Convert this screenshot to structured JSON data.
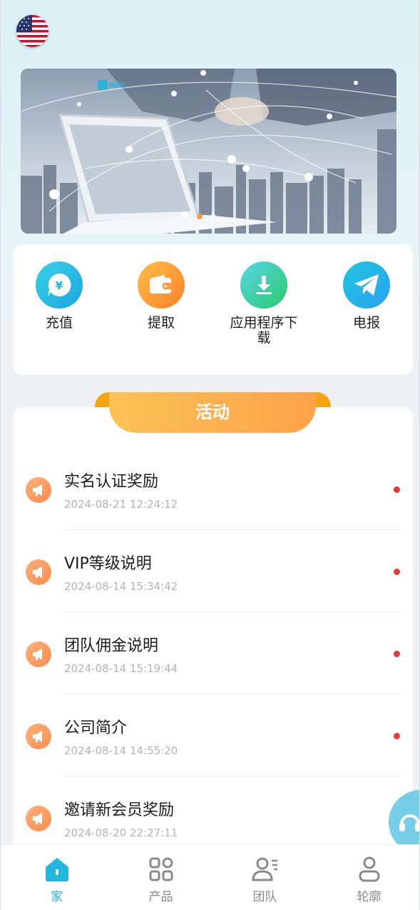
{
  "header": {
    "language_flag": "us-flag-icon"
  },
  "banner": {
    "image": "business handshake over city skyline banner",
    "active_slide": 1,
    "slide_count": 2
  },
  "quick_actions": [
    {
      "label": "充值",
      "icon": "recharge-icon",
      "color": "#1ab6e0"
    },
    {
      "label": "提取",
      "icon": "wallet-icon",
      "color": "#fb8c2f"
    },
    {
      "label": "应用程序下载",
      "icon": "download-icon",
      "color": "#2fd18a"
    },
    {
      "label": "电报",
      "icon": "telegram-icon",
      "color": "#1ab6e0"
    }
  ],
  "activity": {
    "title": "活动",
    "items": [
      {
        "title": "实名认证奖励",
        "time": "2024-08-21 12:24:12"
      },
      {
        "title": "VIP等级说明",
        "time": "2024-08-14 15:34:42"
      },
      {
        "title": "团队佣金说明",
        "time": "2024-08-14 15:19:44"
      },
      {
        "title": "公司简介",
        "time": "2024-08-14 14:55:20"
      },
      {
        "title": "邀请新会员奖励",
        "time": "2024-08-20 22:27:11"
      }
    ]
  },
  "support": {
    "icon": "headset-icon"
  },
  "tabbar": [
    {
      "label": "家",
      "icon": "home-icon",
      "active": true
    },
    {
      "label": "产品",
      "icon": "grid-icon",
      "active": false
    },
    {
      "label": "团队",
      "icon": "team-icon",
      "active": false
    },
    {
      "label": "轮廓",
      "icon": "profile-icon",
      "active": false
    }
  ],
  "colors": {
    "accent": "#20b8db",
    "activity_orange": "#fda24a",
    "unread_dot": "#e53935"
  }
}
